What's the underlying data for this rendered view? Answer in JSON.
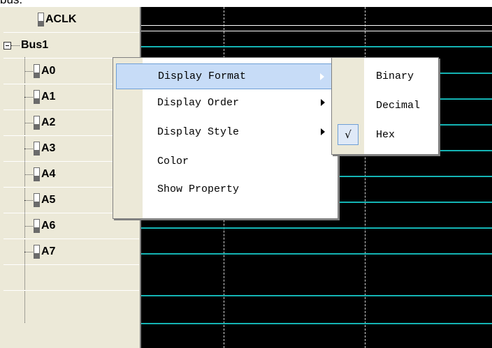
{
  "top_fragment": "bus.",
  "signals": {
    "aclk": "ACLK",
    "bus": "Bus1",
    "children": [
      "A0",
      "A1",
      "A2",
      "A3",
      "A4",
      "A5",
      "A6",
      "A7"
    ]
  },
  "context_menu": {
    "items": [
      {
        "label": "Display Format",
        "has_submenu": true,
        "highlighted": true
      },
      {
        "label": "Display Order",
        "has_submenu": true
      },
      {
        "label": "Display Style",
        "has_submenu": true
      },
      {
        "label": "Color",
        "has_submenu": false
      },
      {
        "label": "Show Property",
        "has_submenu": false
      }
    ]
  },
  "format_submenu": {
    "items": [
      {
        "label": "Binary",
        "checked": false
      },
      {
        "label": "Decimal",
        "checked": false
      },
      {
        "label": "Hex",
        "checked": true
      }
    ],
    "check_glyph": "√"
  },
  "colors": {
    "panel_bg": "#ece9d8",
    "wave": "#14b4b4",
    "highlight": "#c7dcf7"
  }
}
